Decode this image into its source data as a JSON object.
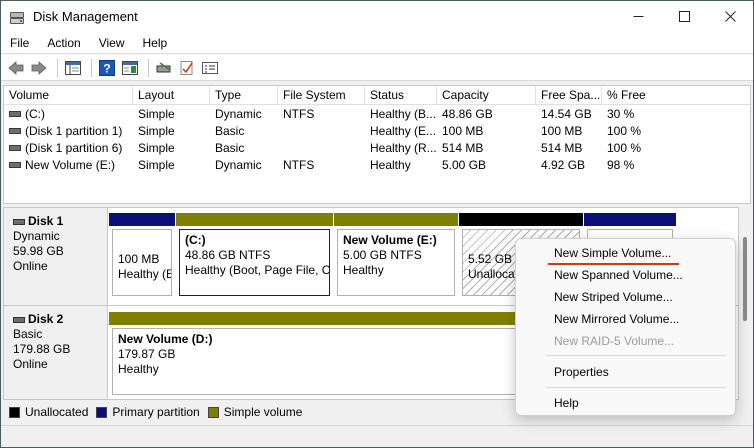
{
  "window": {
    "title": "Disk Management",
    "controls": {
      "minimize": "—",
      "maximize": "☐",
      "close": "✕"
    }
  },
  "menu": [
    "File",
    "Action",
    "View",
    "Help"
  ],
  "toolbar": {
    "icons": [
      "back-arrow-icon",
      "forward-arrow-icon",
      "show-hide-console-tree-icon",
      "help-icon",
      "show-hide-action-pane-icon",
      "connect-disk-icon",
      "check-disk-icon",
      "properties-icon"
    ]
  },
  "volume_list": {
    "columns": [
      "Volume",
      "Layout",
      "Type",
      "File System",
      "Status",
      "Capacity",
      "Free Spa...",
      "% Free"
    ],
    "rows": [
      [
        "(C:)",
        "Simple",
        "Dynamic",
        "NTFS",
        "Healthy (B...",
        "48.86 GB",
        "14.54 GB",
        "30 %"
      ],
      [
        "(Disk 1 partition 1)",
        "Simple",
        "Basic",
        "",
        "Healthy (E...",
        "100 MB",
        "100 MB",
        "100 %"
      ],
      [
        "(Disk 1 partition 6)",
        "Simple",
        "Basic",
        "",
        "Healthy (R...",
        "514 MB",
        "514 MB",
        "100 %"
      ],
      [
        "New Volume (E:)",
        "Simple",
        "Dynamic",
        "NTFS",
        "Healthy",
        "5.00 GB",
        "4.92 GB",
        "98 %"
      ]
    ]
  },
  "disks": [
    {
      "name": "Disk 1",
      "type": "Dynamic",
      "size": "59.98 GB",
      "state": "Online",
      "partitions": [
        {
          "title": "",
          "line1": "100 MB",
          "line2": "Healthy (EFI System Partition)"
        },
        {
          "title": "(C:)",
          "line1": "48.86 GB NTFS",
          "line2": "Healthy (Boot, Page File, Crash Dump)"
        },
        {
          "title": "New Volume  (E:)",
          "line1": "5.00 GB NTFS",
          "line2": "Healthy"
        },
        {
          "title": "",
          "line1": "5.52 GB",
          "line2": "Unallocated"
        },
        {
          "title": "",
          "line1": "",
          "line2": ""
        }
      ]
    },
    {
      "name": "Disk 2",
      "type": "Basic",
      "size": "179.88 GB",
      "state": "Online",
      "partitions": [
        {
          "title": "New Volume  (D:)",
          "line1": "179.87 GB",
          "line2": "Healthy"
        }
      ]
    }
  ],
  "legend": [
    {
      "label": "Unallocated",
      "color": "#000000"
    },
    {
      "label": "Primary partition",
      "color": "#0a0f7a"
    },
    {
      "label": "Simple volume",
      "color": "#808000"
    }
  ],
  "context_menu": {
    "items": [
      {
        "label": "New Simple Volume...",
        "enabled": true
      },
      {
        "label": "New Spanned Volume...",
        "enabled": true
      },
      {
        "label": "New Striped Volume...",
        "enabled": true
      },
      {
        "label": "New Mirrored Volume...",
        "enabled": true
      },
      {
        "label": "New RAID-5 Volume...",
        "enabled": false
      },
      {
        "label": "Properties",
        "enabled": true
      },
      {
        "label": "Help",
        "enabled": true
      }
    ]
  },
  "colors": {
    "primary_partition": "#0a0f7a",
    "simple_volume": "#808000",
    "unallocated": "#000000",
    "highlight_underline": "#cc3b12"
  }
}
